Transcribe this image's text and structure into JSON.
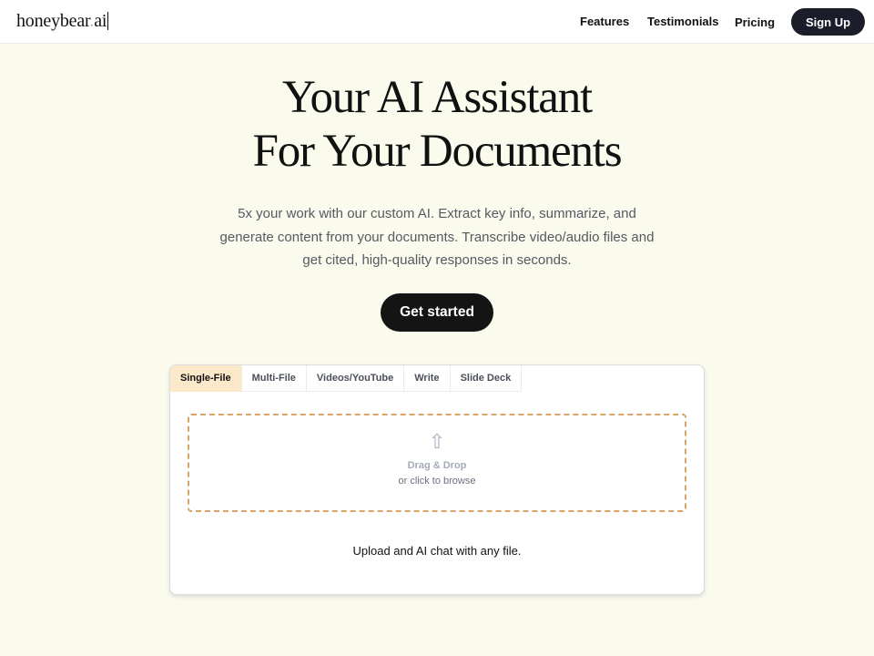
{
  "navbar": {
    "logo_name": "honeybear",
    "logo_dot": ".",
    "logo_tld": "ai",
    "links": [
      "Features",
      "Testimonials",
      "Pricing"
    ],
    "signup_label": "Sign Up"
  },
  "hero": {
    "title_line1": "Your AI Assistant",
    "title_line2": "For Your Documents",
    "subtitle": "5x your work with our custom AI. Extract key info, summarize, and generate content from your documents. Transcribe video/audio files and get cited, high-quality responses in seconds.",
    "cta_label": "Get started"
  },
  "uploader": {
    "tabs": [
      "Single-File",
      "Multi-File",
      "Videos/YouTube",
      "Write",
      "Slide Deck"
    ],
    "active_tab": "Single-File",
    "upload_icon_glyph": "⇧",
    "drag_label": "Drag & Drop",
    "browse_label": "or click to browse",
    "caption": "Upload and AI chat with any file."
  },
  "colors": {
    "background": "#fafaed",
    "signup_button": "#1b1d2b",
    "cta_button": "#141414",
    "active_tab": "#fbe9c9",
    "dropzone_border": "#d9a46a"
  }
}
